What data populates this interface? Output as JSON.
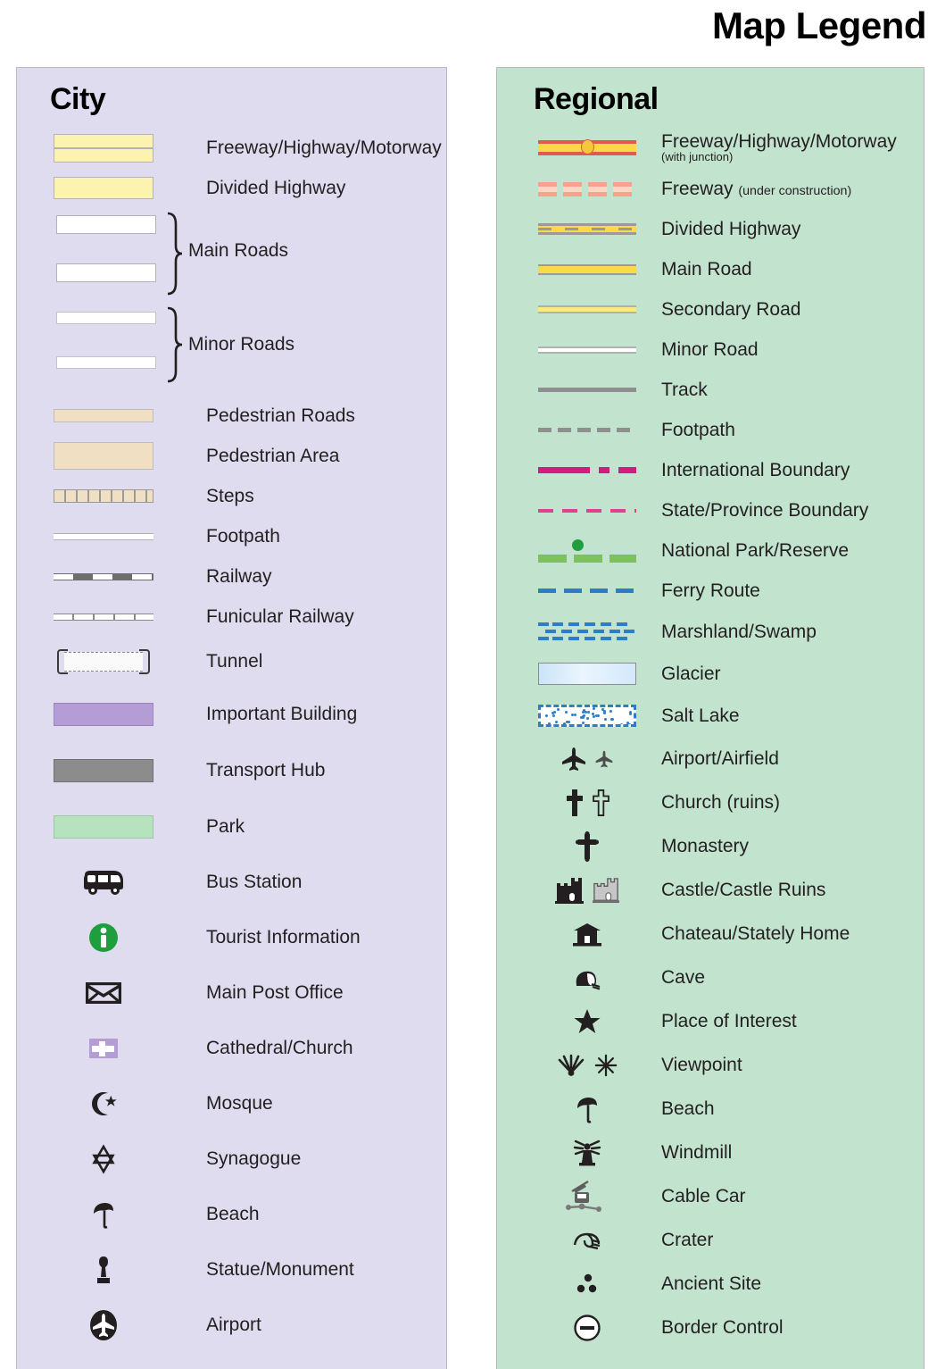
{
  "title": "Map Legend",
  "panels": {
    "city": {
      "heading": "City",
      "bg": "#dedcee",
      "items": [
        {
          "label": "Freeway/Highway/Motorway",
          "symbol": "freeway-double-yellow"
        },
        {
          "label": "Divided Highway",
          "symbol": "divided-highway-yellow"
        },
        {
          "label": "Main Roads",
          "symbol": "main-roads-white-braced",
          "braced": true
        },
        {
          "label": "Minor Roads",
          "symbol": "minor-roads-white-braced",
          "braced": true
        },
        {
          "label": "Pedestrian Roads",
          "symbol": "pedestrian-road-tan"
        },
        {
          "label": "Pedestrian Area",
          "symbol": "pedestrian-area-tan"
        },
        {
          "label": "Steps",
          "symbol": "steps-hatched"
        },
        {
          "label": "Footpath",
          "symbol": "footpath-thin-white"
        },
        {
          "label": "Railway",
          "symbol": "railway-dashed-grey"
        },
        {
          "label": "Funicular Railway",
          "symbol": "funicular-ticked"
        },
        {
          "label": "Tunnel",
          "symbol": "tunnel-bracketed-dashed"
        },
        {
          "label": "Important Building",
          "symbol": "important-building-purple"
        },
        {
          "label": "Transport Hub",
          "symbol": "transport-hub-grey"
        },
        {
          "label": "Park",
          "symbol": "park-green"
        },
        {
          "label": "Bus Station",
          "symbol": "bus-icon"
        },
        {
          "label": "Tourist Information",
          "symbol": "information-icon"
        },
        {
          "label": "Main Post Office",
          "symbol": "envelope-icon"
        },
        {
          "label": "Cathedral/Church",
          "symbol": "church-cross-box-icon"
        },
        {
          "label": "Mosque",
          "symbol": "crescent-star-icon"
        },
        {
          "label": "Synagogue",
          "symbol": "star-of-david-icon"
        },
        {
          "label": "Beach",
          "symbol": "parasol-icon"
        },
        {
          "label": "Statue/Monument",
          "symbol": "statue-icon"
        },
        {
          "label": "Airport",
          "symbol": "airplane-circle-icon"
        }
      ]
    },
    "regional": {
      "heading": "Regional",
      "bg": "#c2e3ce",
      "items": [
        {
          "label": "Freeway/Highway/Motorway",
          "sublabel": "(with junction)",
          "symbol": "freeway-red-junction"
        },
        {
          "label": "Freeway",
          "sublabel": "(under construction)",
          "symbol": "freeway-dashed-pink"
        },
        {
          "label": "Divided Highway",
          "symbol": "divided-highway-yellow-grey"
        },
        {
          "label": "Main Road",
          "symbol": "main-road-yellow"
        },
        {
          "label": "Secondary Road",
          "symbol": "secondary-road-pale-yellow"
        },
        {
          "label": "Minor Road",
          "symbol": "minor-road-white"
        },
        {
          "label": "Track",
          "symbol": "track-solid-grey"
        },
        {
          "label": "Footpath",
          "symbol": "footpath-dashed-grey"
        },
        {
          "label": "International Boundary",
          "symbol": "international-boundary-magenta"
        },
        {
          "label": "State/Province Boundary",
          "symbol": "state-boundary-pink-dashed"
        },
        {
          "label": "National Park/Reserve",
          "symbol": "national-park-green-dashed-dot"
        },
        {
          "label": "Ferry Route",
          "symbol": "ferry-route-blue-dashed"
        },
        {
          "label": "Marshland/Swamp",
          "symbol": "marshland-blue-dashes"
        },
        {
          "label": "Glacier",
          "symbol": "glacier-pale-blue"
        },
        {
          "label": "Salt Lake",
          "symbol": "salt-lake-stippled"
        },
        {
          "label": "Airport/Airfield",
          "symbol": "airplane-pair-icon"
        },
        {
          "label": "Church (ruins)",
          "symbol": "cross-pair-icon"
        },
        {
          "label": "Monastery",
          "symbol": "ornate-cross-icon"
        },
        {
          "label": "Castle/Castle Ruins",
          "symbol": "castle-pair-icon"
        },
        {
          "label": "Chateau/Stately Home",
          "symbol": "chateau-icon"
        },
        {
          "label": "Cave",
          "symbol": "cave-icon"
        },
        {
          "label": "Place of Interest",
          "symbol": "star-icon"
        },
        {
          "label": "Viewpoint",
          "symbol": "viewpoint-pair-icon"
        },
        {
          "label": "Beach",
          "symbol": "parasol-icon"
        },
        {
          "label": "Windmill",
          "symbol": "windmill-icon"
        },
        {
          "label": "Cable Car",
          "symbol": "cable-car-icon"
        },
        {
          "label": "Crater",
          "symbol": "crater-icon"
        },
        {
          "label": "Ancient Site",
          "symbol": "ancient-site-dots-icon"
        },
        {
          "label": "Border Control",
          "symbol": "border-control-icon"
        }
      ]
    }
  },
  "colors": {
    "city_panel_bg": "#dedcee",
    "regional_panel_bg": "#c2e3ce",
    "highway_yellow": "#fcf3b0",
    "freeway_red": "#e05a4e",
    "road_yellow": "#fcd84a",
    "boundary_magenta": "#d4197f",
    "ferry_blue": "#2b7ec9",
    "park_green": "#7cc05f",
    "building_purple": "#b49cd4",
    "info_green": "#1f9e3e"
  }
}
